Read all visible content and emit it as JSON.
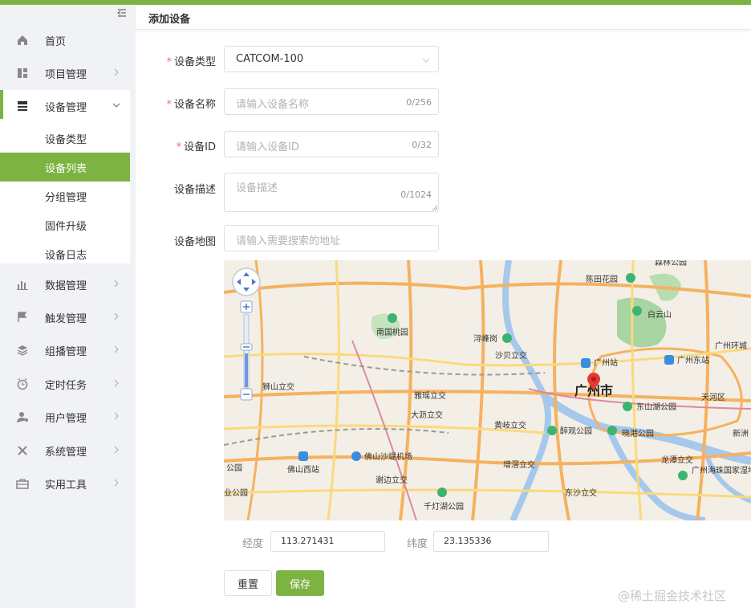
{
  "app": {
    "accent": "#7cb342"
  },
  "sidebar": {
    "items": [
      {
        "label": "首页",
        "icon": "home-icon"
      },
      {
        "label": "项目管理",
        "icon": "project-icon"
      },
      {
        "label": "设备管理",
        "icon": "device-icon"
      },
      {
        "label": "数据管理",
        "icon": "chart-icon"
      },
      {
        "label": "触发管理",
        "icon": "flag-icon"
      },
      {
        "label": "组播管理",
        "icon": "layers-icon"
      },
      {
        "label": "定时任务",
        "icon": "clock-icon"
      },
      {
        "label": "用户管理",
        "icon": "user-icon"
      },
      {
        "label": "系统管理",
        "icon": "tools-icon"
      },
      {
        "label": "实用工具",
        "icon": "toolbox-icon"
      }
    ],
    "sub_items": [
      {
        "label": "设备类型"
      },
      {
        "label": "设备列表"
      },
      {
        "label": "分组管理"
      },
      {
        "label": "固件升级"
      },
      {
        "label": "设备日志"
      }
    ]
  },
  "header": {
    "title": "添加设备"
  },
  "form": {
    "type": {
      "label": "设备类型",
      "value": "CATCOM-100"
    },
    "name": {
      "label": "设备名称",
      "placeholder": "请输入设备名称",
      "count": "0/256"
    },
    "id": {
      "label": "设备ID",
      "placeholder": "请输入设备ID",
      "count": "0/32"
    },
    "desc": {
      "label": "设备描述",
      "placeholder": "设备描述",
      "count": "0/1024"
    },
    "map": {
      "label": "设备地图",
      "placeholder": "请输入需要搜索的地址"
    }
  },
  "map": {
    "labels": {
      "chenpi": "陈田花园",
      "baiyun": "白云山",
      "nanguo": "南国桃园",
      "xunfeng": "浔峰岗",
      "shabei": "沙贝立交",
      "gzstation": "广州站",
      "gzeast": "广州东站",
      "gzcity": "广州市",
      "shishan": "狮山立交",
      "yagang": "雅瑶立交",
      "dali": "大沥立交",
      "huangqi": "黄岐立交",
      "dongshan": "东山湖公园",
      "tianhe": "天河区",
      "zuihua": "醉观公园",
      "xiaogang": "晓港公园",
      "foshanwest": "佛山西站",
      "airport": "佛山沙堤机场",
      "zengcha": "增滘立交",
      "longtan": "龙潭立交",
      "haizhu": "广州海珠国家湿地公园",
      "xiebian": "谢边立交",
      "qiandeng": "千灯湖公园",
      "dongsha": "东沙立交",
      "forest": "森林公园",
      "ringroad": "广州环城",
      "xinzhou": "新洲",
      "park1": "公园",
      "park2": "业公园"
    }
  },
  "coords": {
    "lng_label": "经度",
    "lng_value": "113.271431",
    "lat_label": "纬度",
    "lat_value": "23.135336"
  },
  "buttons": {
    "reset": "重置",
    "save": "保存"
  },
  "watermark": "@稀土掘金技术社区"
}
